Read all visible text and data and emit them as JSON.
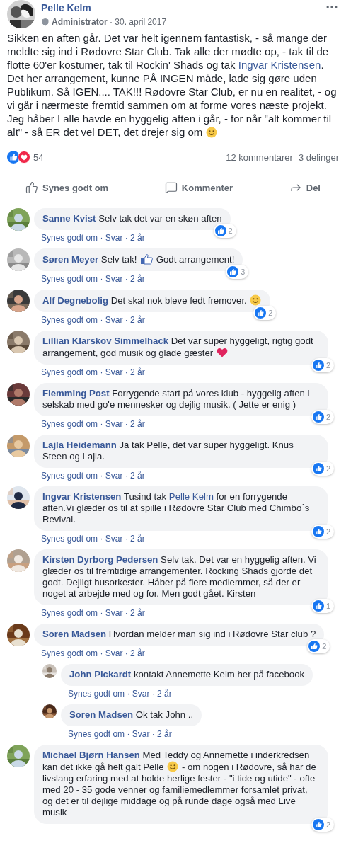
{
  "post": {
    "author": "Pelle Kelm",
    "meta": "**Administrator** · 30. april 2017",
    "body": [
      {
        "kind": "text",
        "text": "Sikken en aften går. Det var helt igennem fantastisk, - så mange der meldte sig ind i Rødovre Star Club. Tak alle der mødte op, - tak til de flotte 60'er kostumer, tak til Rockin' Shads og tak "
      },
      {
        "kind": "mention",
        "text": "Ingvar Kristensen"
      },
      {
        "kind": "text",
        "text": ". Det her arrangement, kunne PÅ INGEN måde, lade sig gøre uden Publikum. Så IGEN.... TAK!!! Rødovre Star Club, er nu en realitet, - og vi går i nærmeste fremtid sammen om at forme vores næste projekt. Jeg håber I alle havde en hyggelig aften i går, - for når \"alt kommer til alt\" - så ER det vel DET, det drejer sig om "
      },
      {
        "kind": "smile"
      }
    ],
    "reactions": [
      {
        "kind": "like"
      },
      {
        "kind": "love"
      }
    ],
    "reaction_count": "54",
    "comments_count": "12 kommentarer",
    "shares_count": "3 delinger",
    "actions": [
      {
        "kind": "like",
        "label": "Synes godt om"
      },
      {
        "kind": "comment",
        "label": "Kommenter"
      },
      {
        "kind": "share",
        "label": "Del"
      }
    ]
  },
  "comments": [
    {
      "author": "Sanne Kvist",
      "body": [
        {
          "kind": "text",
          "text": "Selv tak det var en skøn aften"
        }
      ],
      "likes": "2",
      "meta": "Synes godt om · Svar · 2 år"
    },
    {
      "author": "Søren Meyer",
      "body": [
        {
          "kind": "text",
          "text": "Selv tak! "
        },
        {
          "kind": "thumb"
        },
        {
          "kind": "text",
          "text": " Godt arrangement!"
        }
      ],
      "likes": "3",
      "meta": "Synes godt om · Svar · 2 år"
    },
    {
      "author": "Alf Degnebolig",
      "body": [
        {
          "kind": "text",
          "text": "Det skal nok bleve fedt fremover. "
        },
        {
          "kind": "smile"
        }
      ],
      "likes": "2",
      "meta": "Synes godt om · Svar · 2 år"
    },
    {
      "author": "Lillian Klarskov Simmelhack",
      "body": [
        {
          "kind": "text",
          "text": "Det var super hyggeligt, rigtig godt arrangement, god musik og glade gæster "
        },
        {
          "kind": "heart"
        }
      ],
      "likes": "2",
      "meta": "Synes godt om · Svar · 2 år"
    },
    {
      "author": "Flemming Post",
      "body": [
        {
          "kind": "text",
          "text": "Forrygende start på vores klub - hyggelig aften i selskab med go'e mennesker og dejlig musik. ( Jette er enig )"
        }
      ],
      "likes": "2",
      "meta": "Synes godt om · Svar · 2 år"
    },
    {
      "author": "Lajla Heidemann",
      "body": [
        {
          "kind": "text",
          "text": "Ja tak Pelle, det var super hyggeligt. Knus Steen og Lajla."
        }
      ],
      "likes": "2",
      "meta": "Synes godt om · Svar · 2 år"
    },
    {
      "author": "Ingvar Kristensen",
      "body": [
        {
          "kind": "text",
          "text": "Tusind tak "
        },
        {
          "kind": "mention",
          "text": "Pelle Kelm"
        },
        {
          "kind": "text",
          "text": " for en forrygende aften.Vi glæder os til at spille i Rødovre Star Club med Chimbo´s Revival."
        }
      ],
      "likes": "2",
      "meta": "Synes godt om · Svar · 2 år"
    },
    {
      "author": "Kirsten Dyrborg Pedersen",
      "body": [
        {
          "kind": "text",
          "text": "Selv tak. Det var en hyggelig aften. Vi glæder os til fremtidige arrangementer. Rocking Shads gjorde det godt. Dejligt husorkester. Håber på flere medlemmer, så der er noget at arbejde med og for. Men godt gået. Kirsten"
        }
      ],
      "likes": "1",
      "meta": "Synes godt om · Svar · 2 år"
    },
    {
      "author": "Soren Madsen",
      "body": [
        {
          "kind": "text",
          "text": "Hvordan melder man sig ind i Rødovre Star club ?"
        }
      ],
      "likes": "2",
      "meta": "Synes godt om · Svar · 2 år",
      "replies": [
        {
          "author": "John Pickardt",
          "body": [
            {
              "kind": "text",
              "text": "kontakt Annemette Kelm her på facebook"
            }
          ],
          "meta": "Synes godt om · Svar · 2 år"
        },
        {
          "author": "Soren Madsen",
          "body": [
            {
              "kind": "text",
              "text": "Ok tak John .."
            }
          ],
          "meta": "Synes godt om · Svar · 2 år"
        }
      ]
    },
    {
      "author": "Michael Bjørn Hansen",
      "body": [
        {
          "kind": "text",
          "text": "Med Teddy og Annemette i inderkredsen kan det ikke gå helt galt Pelle "
        },
        {
          "kind": "wink"
        },
        {
          "kind": "text",
          "text": " - om nogen i Rødovre, så har de livslang erfaring med at holde herlige fester - \"i tide og utide\" - ofte med 20 - 35 gode venner og familiemedlemmer forsamlet privat, og det er til dejlige middage og på runde dage også med Live musik"
        }
      ],
      "likes": "2"
    }
  ]
}
